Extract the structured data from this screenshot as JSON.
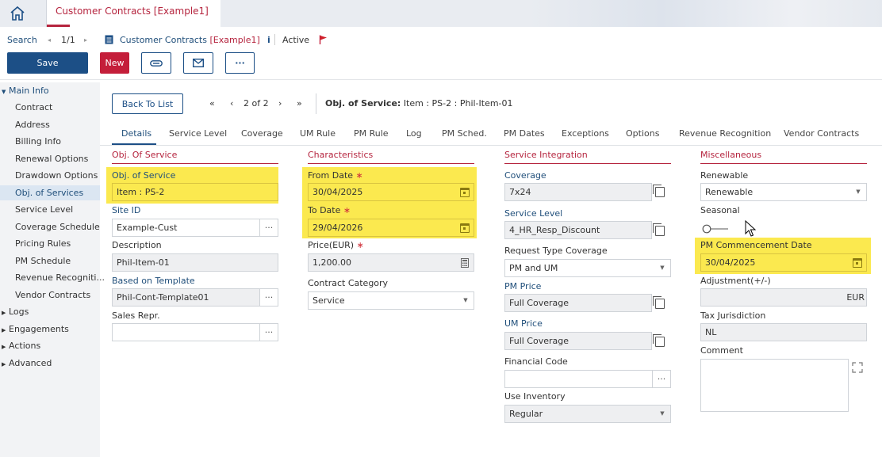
{
  "header": {
    "app_tab": "Customer Contracts [Example1]"
  },
  "nav": {
    "search": "Search",
    "record_pos": "1/1",
    "record_title": "Customer Contracts",
    "record_key": "[Example1]",
    "info": "i",
    "status": "Active"
  },
  "toolbar": {
    "save": "Save",
    "new": "New",
    "more": "···"
  },
  "sidebar": {
    "groups": {
      "main": "Main Info",
      "logs": "Logs",
      "engagements": "Engagements",
      "actions": "Actions",
      "advanced": "Advanced"
    },
    "items": [
      "Contract",
      "Address",
      "Billing Info",
      "Renewal Options",
      "Drawdown Options",
      "Obj. of Services",
      "Service Level",
      "Coverage Schedule",
      "Pricing Rules",
      "PM Schedule",
      "Revenue Recogniti...",
      "Vendor Contracts"
    ]
  },
  "content": {
    "back_to_list": "Back To List",
    "pager": "2 of 2",
    "title_label": "Obj. of Service:",
    "title_value": "Item : PS-2 : Phil-Item-01"
  },
  "tabs": [
    "Details",
    "Service Level",
    "Coverage",
    "UM Rule",
    "PM Rule",
    "Log",
    "PM Sched.",
    "PM Dates",
    "Exceptions",
    "Options",
    "Revenue Recognition",
    "Vendor Contracts"
  ],
  "sections": {
    "obj": {
      "head": "Obj. Of Service",
      "obj_label": "Obj. of Service",
      "obj_value": "Item : PS-2",
      "site_label": "Site ID",
      "site_value": "Example-Cust",
      "desc_label": "Description",
      "desc_value": "Phil-Item-01",
      "tmpl_label": "Based on Template",
      "tmpl_value": "Phil-Cont-Template01",
      "sales_label": "Sales Repr.",
      "sales_value": ""
    },
    "char": {
      "head": "Characteristics",
      "from_label": "From Date",
      "from_value": "30/04/2025",
      "to_label": "To Date",
      "to_value": "29/04/2026",
      "price_label": "Price(EUR)",
      "price_value": "1,200.00",
      "cat_label": "Contract Category",
      "cat_value": "Service"
    },
    "svc": {
      "head": "Service Integration",
      "cov_label": "Coverage",
      "cov_value": "7x24",
      "sl_label": "Service Level",
      "sl_value": "4_HR_Resp_Discount",
      "rtc_label": "Request Type Coverage",
      "rtc_value": "PM and UM",
      "pmp_label": "PM Price",
      "pmp_value": "Full Coverage",
      "ump_label": "UM Price",
      "ump_value": "Full Coverage",
      "fc_label": "Financial Code",
      "fc_value": "",
      "ui_label": "Use Inventory",
      "ui_value": "Regular"
    },
    "misc": {
      "head": "Miscellaneous",
      "ren_label": "Renewable",
      "ren_value": "Renewable",
      "sea_label": "Seasonal",
      "pmc_label": "PM Commencement Date",
      "pmc_value": "30/04/2025",
      "adj_label": "Adjustment(+/-)",
      "adj_value": "EUR",
      "tax_label": "Tax Jurisdiction",
      "tax_value": "NL",
      "com_label": "Comment",
      "com_value": ""
    }
  },
  "colors": {
    "brand_blue": "#1c4f86",
    "brand_red": "#c41e3a",
    "highlight": "#fbe94f"
  }
}
